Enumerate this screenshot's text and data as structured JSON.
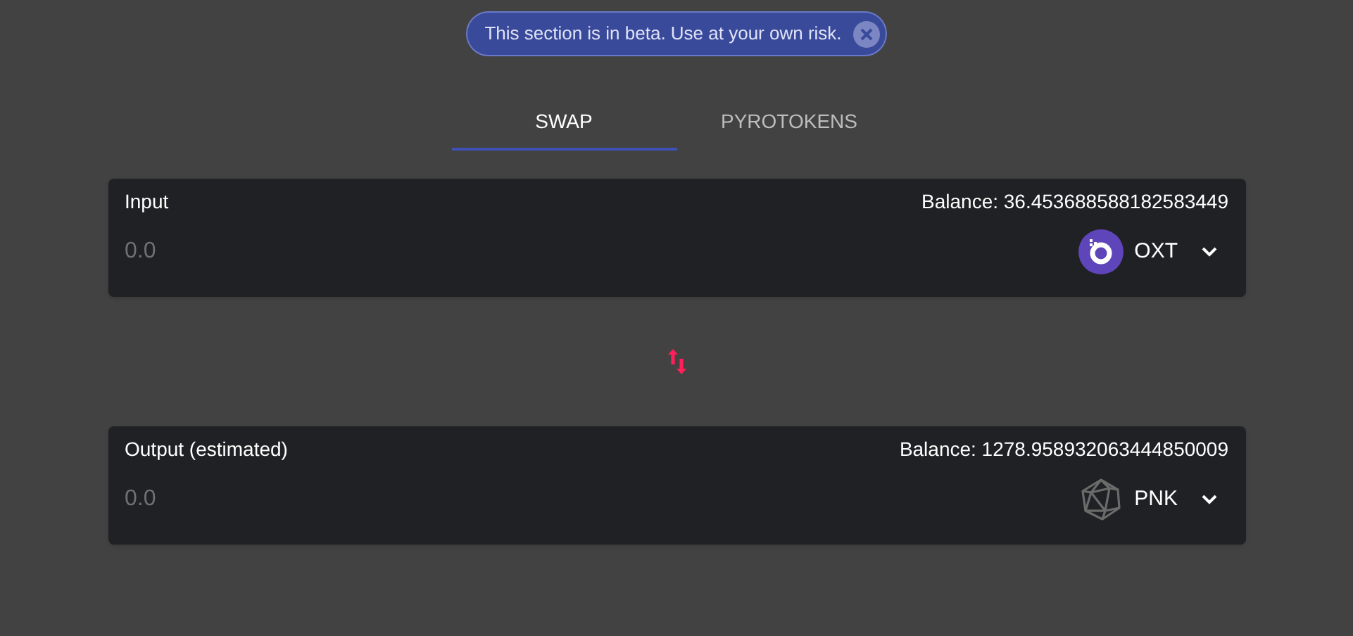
{
  "banner": {
    "message": "This section is in beta. Use at your own risk."
  },
  "tabs": [
    {
      "label": "SWAP",
      "selected": true
    },
    {
      "label": "PYROTOKENS",
      "selected": false
    }
  ],
  "panels": [
    {
      "label": "Input",
      "balance": "Balance: 36.453688588182583449",
      "amount_placeholder": "0.0",
      "token": "OXT",
      "kind": "oxt"
    },
    {
      "label": "Output (estimated)",
      "balance": "Balance: 1278.958932063444850009",
      "amount_placeholder": "0.0",
      "token": "PNK",
      "kind": "pnk"
    }
  ]
}
